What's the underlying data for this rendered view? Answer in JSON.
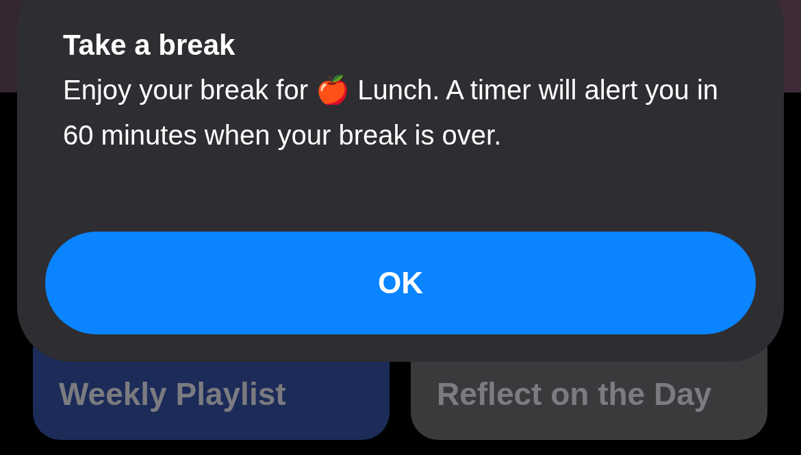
{
  "dialog": {
    "title": "Take a break",
    "message": "Enjoy your break for 🍎 Lunch. A timer will alert you in 60 minutes when your break is over.",
    "button": "OK"
  },
  "cards": [
    {
      "title": "Weekly Playlist",
      "color": "#1c2b58"
    },
    {
      "title": "Reflect on the Day",
      "color": "#3a3a3c"
    }
  ]
}
